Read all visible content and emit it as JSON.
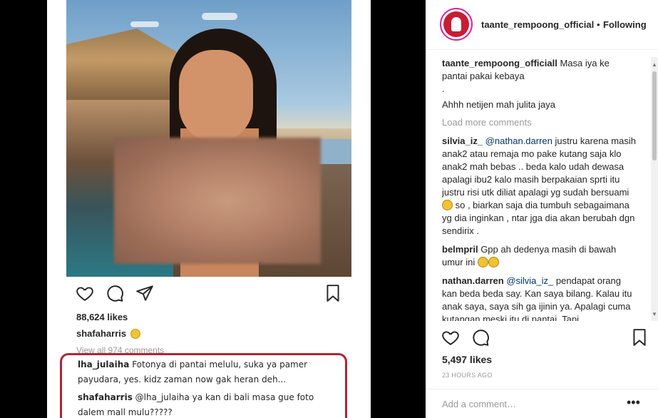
{
  "left_post": {
    "likes": "88,624 likes",
    "caption_user": "shafaharris",
    "view_all": "View all 974 comments",
    "highlighted_comments": [
      {
        "user": "lha_julaiha",
        "text": " Fotonya di pantai melulu, suka ya pamer payudara, yes. kidz zaman now gak heran deh..."
      },
      {
        "user": "shafaharris",
        "text": " @lha_julaiha ya kan di bali masa gue foto dalem mall mulu?????"
      }
    ],
    "highlight_color": "#b52334"
  },
  "right_panel": {
    "header": {
      "username": "taante_rempoong_official",
      "separator": "•",
      "follow_status": "Following"
    },
    "caption": {
      "user": "taante_rempoong_officiall",
      "lines": [
        "Masa iya ke pantai pakai kebaya",
        ".",
        "Ahhh netijen mah julita jaya"
      ]
    },
    "load_more": "Load more comments",
    "comments": [
      {
        "user": "silvia_iz_",
        "mention": "@nathan.darren",
        "text_before_emoji": " justru karena masih anak2 atau remaja mo pake kutang saja klo anak2 mah bebas .. beda kalo udah dewasa apalagi ibu2 kalo masih berpakaian sprti itu justru risi utk diliat apalagi yg sudah bersuami",
        "text_after_emoji": " so , biarkan saja dia tumbuh sebagaimana yg dia inginkan , ntar jga dia akan berubah dgn sendirix ."
      },
      {
        "user": "belmpril",
        "text": " Gpp ah dedenya masih di bawah umur ini"
      },
      {
        "user": "nathan.darren",
        "mention": "@silvia_iz_",
        "text": " pendapat orang kan beda beda say. Kan saya bilang. Kalau itu anak saya, saya sih ga ijinin ya. Apalagi cuma kutangan meski itu di pantai. Tapi"
      }
    ],
    "likes": "5,497 likes",
    "time": "23 HOURS AGO",
    "comment_placeholder": "Add a comment…",
    "more": "•••"
  },
  "icons": [
    "heart-icon",
    "comment-icon",
    "share-icon",
    "bookmark-icon"
  ],
  "colors": {
    "text": "#262626",
    "muted": "#999999",
    "mention": "#003569",
    "background": "#000000"
  }
}
